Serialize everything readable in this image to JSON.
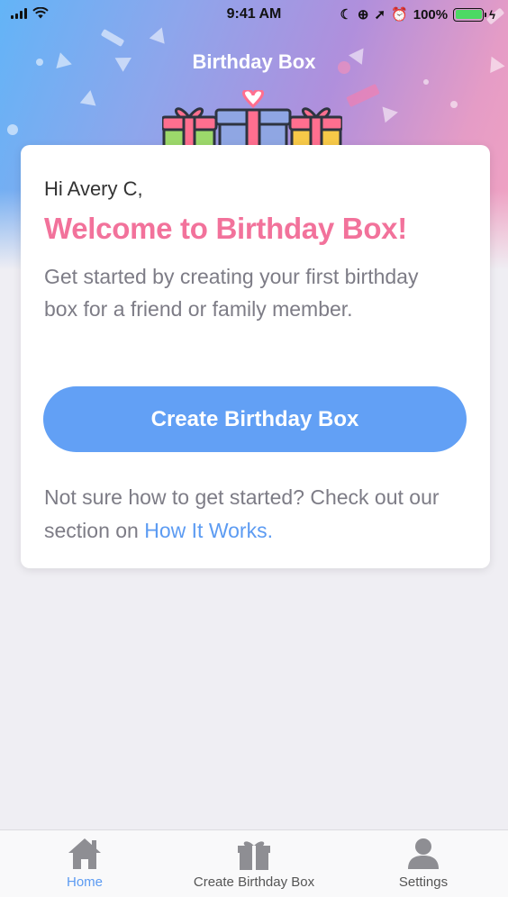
{
  "status_bar": {
    "time": "9:41 AM",
    "battery": "100%"
  },
  "header": {
    "title": "Birthday Box"
  },
  "card": {
    "greeting": "Hi Avery C,",
    "welcome": "Welcome to Birthday Box!",
    "intro": "Get started by creating your first birthday box for a friend or family member.",
    "cta_label": "Create Birthday Box",
    "help_text": "Not sure how to get started? Check out our section on ",
    "help_link": "How It Works."
  },
  "tab_bar": {
    "items": [
      {
        "label": "Home",
        "icon": "home-icon",
        "active": true
      },
      {
        "label": "Create Birthday Box",
        "icon": "gift-icon",
        "active": false
      },
      {
        "label": "Settings",
        "icon": "user-icon",
        "active": false
      }
    ]
  },
  "colors": {
    "accent_pink": "#f2729b",
    "button_blue": "#62a0f5",
    "link_blue": "#5c9bf2",
    "battery_green": "#4cd964"
  }
}
